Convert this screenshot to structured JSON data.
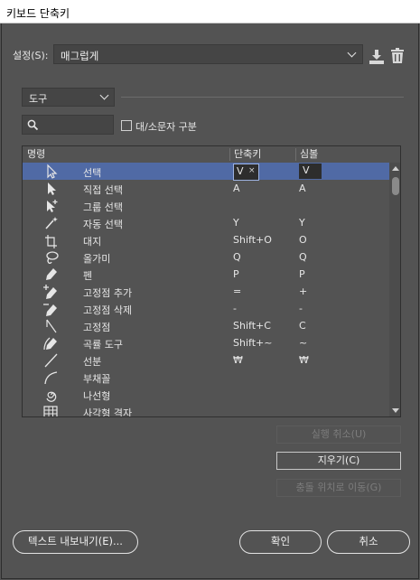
{
  "window": {
    "title": "키보드 단축키"
  },
  "settings": {
    "label": "설정(S):",
    "value": "매그럽게"
  },
  "category": {
    "value": "도구"
  },
  "search": {
    "value": ""
  },
  "case_sensitive": {
    "label": "대/소문자 구분",
    "checked": false
  },
  "table": {
    "headers": {
      "command": "명령",
      "shortcut": "단축키",
      "symbol": "심볼"
    },
    "rows": [
      {
        "icon": "selection-arrow-icon",
        "name": "선택",
        "shortcut": "V",
        "symbol": "V",
        "selected": true
      },
      {
        "icon": "direct-selection-icon",
        "name": "직접 선택",
        "shortcut": "A",
        "symbol": "A"
      },
      {
        "icon": "group-selection-icon",
        "name": "그룹 선택",
        "shortcut": "",
        "symbol": ""
      },
      {
        "icon": "magic-wand-icon",
        "name": "자동 선택",
        "shortcut": "Y",
        "symbol": "Y"
      },
      {
        "icon": "artboard-icon",
        "name": "대지",
        "shortcut": "Shift+O",
        "symbol": "O"
      },
      {
        "icon": "lasso-icon",
        "name": "올가미",
        "shortcut": "Q",
        "symbol": "Q"
      },
      {
        "icon": "pen-icon",
        "name": "펜",
        "shortcut": "P",
        "symbol": "P"
      },
      {
        "icon": "add-anchor-point-icon",
        "name": "고정점 추가",
        "shortcut": "=",
        "symbol": "+"
      },
      {
        "icon": "delete-anchor-point-icon",
        "name": "고정점 삭제",
        "shortcut": "-",
        "symbol": "-"
      },
      {
        "icon": "anchor-point-icon",
        "name": "고정점",
        "shortcut": "Shift+C",
        "symbol": "C"
      },
      {
        "icon": "curvature-icon",
        "name": "곡률 도구",
        "shortcut": "Shift+~",
        "symbol": "~"
      },
      {
        "icon": "line-segment-icon",
        "name": "선분",
        "shortcut": "₩",
        "symbol": "₩"
      },
      {
        "icon": "arc-icon",
        "name": "부채꼴",
        "shortcut": "",
        "symbol": ""
      },
      {
        "icon": "spiral-icon",
        "name": "나선형",
        "shortcut": "",
        "symbol": ""
      },
      {
        "icon": "rectangular-grid-icon",
        "name": "사각형 격자",
        "shortcut": "",
        "symbol": ""
      }
    ]
  },
  "buttons": {
    "undo": "실행 취소(U)",
    "clear": "지우기(C)",
    "go_conflict": "충돌 위치로 이동(G)",
    "export": "텍스트 내보내기(E)...",
    "ok": "확인",
    "cancel": "취소"
  }
}
